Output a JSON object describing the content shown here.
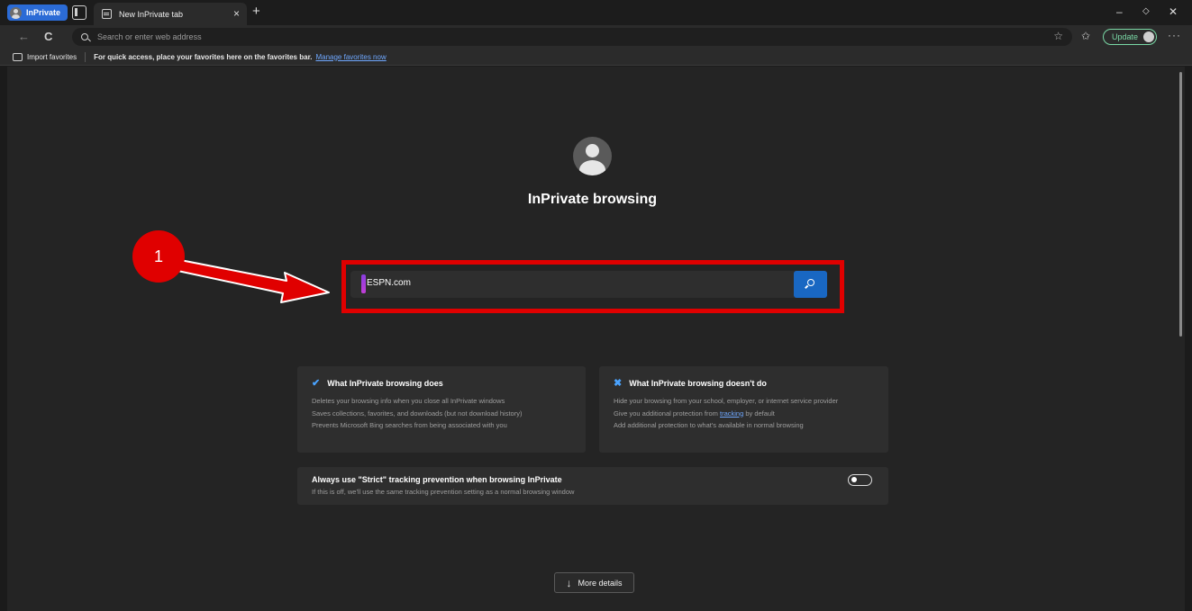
{
  "titlebar": {
    "inprivate_label": "InPrivate",
    "tab_title": "New InPrivate tab",
    "tab_close": "×",
    "new_tab": "+",
    "minimize": "–",
    "restore": "◇",
    "close": "✕"
  },
  "navbar": {
    "back": "←",
    "refresh": "C",
    "address_placeholder": "Search or enter web address",
    "favorite_star": "☆",
    "favorites": "✩",
    "update_label": "Update",
    "more": "···"
  },
  "favorites_bar": {
    "import_label": "Import favorites",
    "hint": "For quick access, place your favorites here on the favorites bar.",
    "manage_link": "Manage favorites now"
  },
  "page": {
    "title": "InPrivate browsing",
    "search_value": "ESPN.com",
    "does_card": {
      "title": "What InPrivate browsing does",
      "icon": "✔",
      "items": [
        "Deletes your browsing info when you close all InPrivate windows",
        "Saves collections, favorites, and downloads (but not download history)",
        "Prevents Microsoft Bing searches from being associated with you"
      ]
    },
    "doesnt_card": {
      "title": "What InPrivate browsing doesn't do",
      "icon": "✖",
      "item1": "Hide your browsing from your school, employer, or internet service provider",
      "item2_pre": "Give you additional protection from ",
      "item2_link": "tracking",
      "item2_post": " by default",
      "item3": "Add additional protection to what's available in normal browsing"
    },
    "strict": {
      "title": "Always use \"Strict\" tracking prevention when browsing InPrivate",
      "subtitle": "If this is off, we'll use the same tracking prevention setting as a normal browsing window",
      "enabled": false
    },
    "more_details": "More details",
    "more_details_icon": "↓"
  },
  "annotation": {
    "step_number": "1",
    "color": "#e00000"
  },
  "colors": {
    "accent": "#2b6bd6",
    "search_button": "#1967c2",
    "update": "#7ad9a6",
    "link": "#6fa8ff"
  }
}
